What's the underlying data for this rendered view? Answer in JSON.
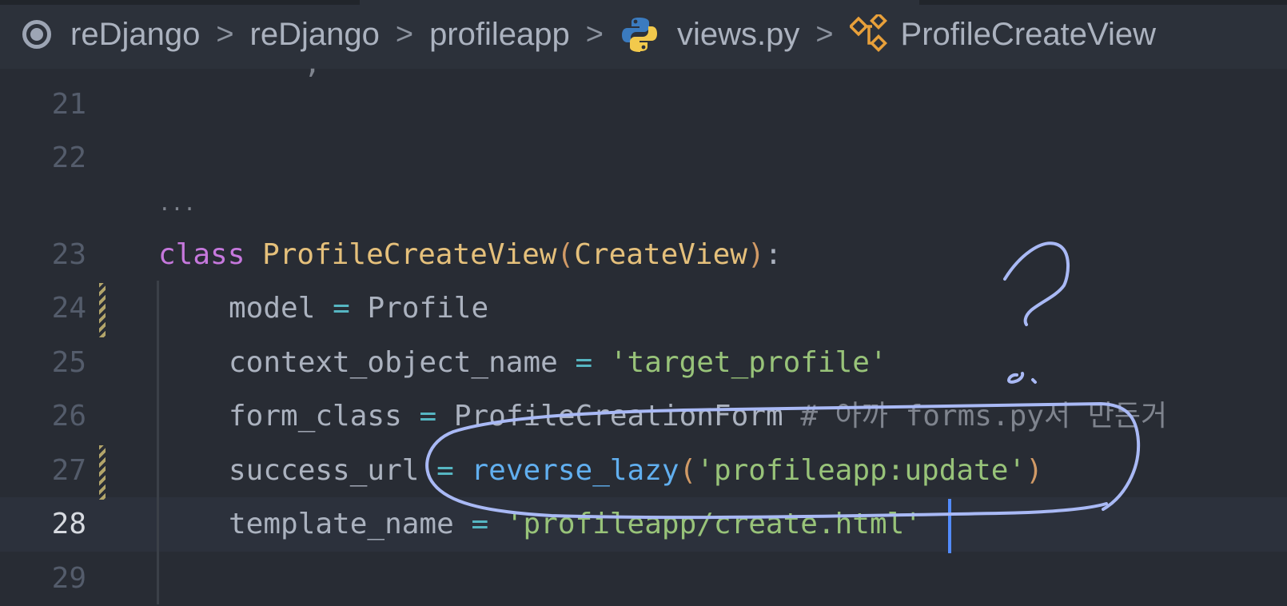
{
  "breadcrumb": {
    "items": [
      "reDjango",
      "reDjango",
      "profileapp",
      "views.py",
      "ProfileCreateView"
    ],
    "separator": ">"
  },
  "editor": {
    "folded_indicator": "...",
    "lines": [
      {
        "number": "21"
      },
      {
        "number": "22"
      },
      {
        "number": "23",
        "kw": "class",
        "name": "ProfileCreateView",
        "paren_open": "(",
        "base": "CreateView",
        "paren_close": ")",
        "colon": ":"
      },
      {
        "number": "24",
        "var": "model",
        "op": "=",
        "value": "Profile"
      },
      {
        "number": "25",
        "var": "context_object_name",
        "op": "=",
        "value": "'target_profile'"
      },
      {
        "number": "26",
        "var": "form_class",
        "op": "=",
        "value": "ProfileCreationForm",
        "comment": "# 아까 forms.py서 만든거"
      },
      {
        "number": "27",
        "var": "success_url",
        "op": "=",
        "func": "reverse_lazy",
        "paren_open": "(",
        "arg": "'profileapp:update'",
        "paren_close": ")"
      },
      {
        "number": "28",
        "var": "template_name",
        "op": "=",
        "value": "'profileapp/create.html'"
      },
      {
        "number": "29"
      }
    ]
  },
  "colors": {
    "background": "#282c34",
    "keyword": "#c678dd",
    "class_name": "#e5c07b",
    "function": "#61afef",
    "string": "#98c379",
    "operator": "#56b6c2",
    "comment": "#7f848e",
    "annotation_ink": "#a9b9f5",
    "cursor": "#528bff"
  },
  "icons": {
    "record": "record-icon",
    "python": "python-icon",
    "class": "class-symbol-icon"
  }
}
